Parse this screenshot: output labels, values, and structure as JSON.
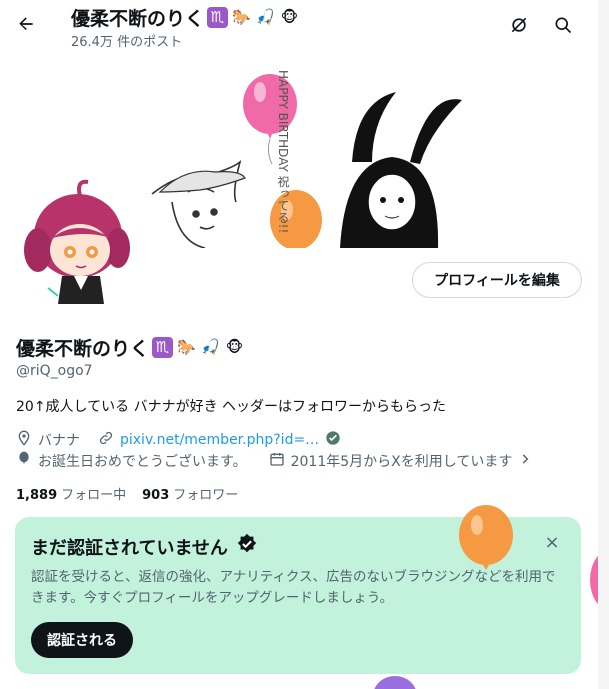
{
  "header": {
    "title": "優柔不断のりく",
    "title_emojis": [
      "♏",
      "🐎",
      "🎣",
      "🐵"
    ],
    "post_count": "26.4万 件のポスト"
  },
  "banner": {
    "vertical_text": "HAPPY BIRTHDAY 祝ってる!!"
  },
  "profile": {
    "edit_button": "プロフィールを編集",
    "name": "優柔不断のりく",
    "name_emojis": [
      "♏",
      "🐎",
      "🎣",
      "🐵"
    ],
    "handle": "@riQ_ogo7",
    "bio": "20↑成人している バナナが好き ヘッダーはフォロワーからもらった",
    "location": "バナナ",
    "link": "pixiv.net/member.php?id=…",
    "birthday": "お誕生日おめでとうございます。",
    "joined": "2011年5月からXを利用しています",
    "following_count": "1,889",
    "following_label": "フォロー中",
    "followers_count": "903",
    "followers_label": "フォロワー"
  },
  "verify": {
    "title": "まだ認証されていません",
    "description": "認証を受けると、返信の強化、アナリティクス、広告のないブラウジングなどを利用できます。今すぐプロフィールをアップグレードしましょう。",
    "button": "認証される",
    "close": "×"
  },
  "colors": {
    "accent": "#1d9bf0",
    "verify_bg": "#c2f1dc",
    "balloon_pink": "#f06aa7",
    "balloon_orange": "#f59a42"
  }
}
